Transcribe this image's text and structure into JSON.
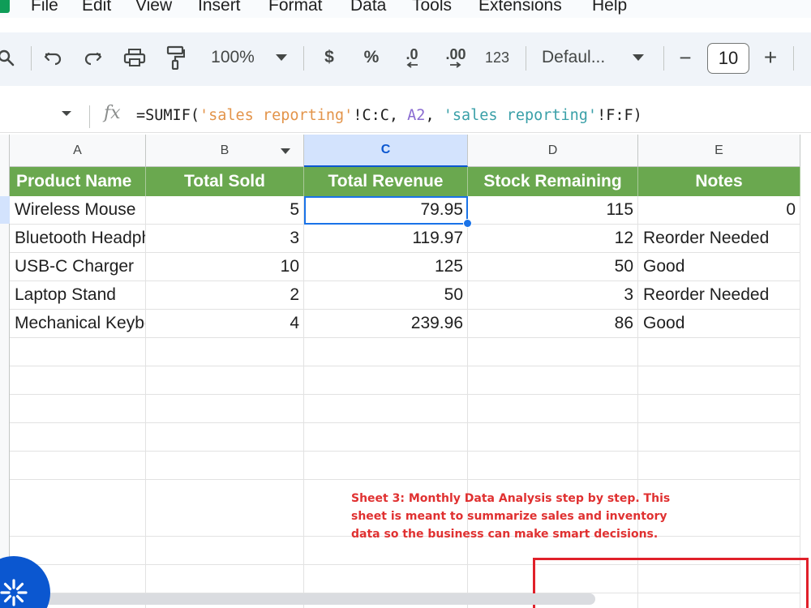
{
  "menu": [
    "File",
    "Edit",
    "View",
    "Insert",
    "Format",
    "Data",
    "Tools",
    "Extensions",
    "Help"
  ],
  "toolbar": {
    "zoom": "100%",
    "currency": "$",
    "percent": "%",
    "decrease_decimal": ".0",
    "increase_decimal": ".00",
    "number_format": "123",
    "font": "Defaul...",
    "decrease_size": "−",
    "font_size": "10",
    "increase_size": "+"
  },
  "formula_bar": {
    "fx": "fx",
    "formula_parts": [
      "=SUMIF(",
      "'sales reporting'",
      "!C:C, ",
      "A2",
      ", ",
      "'sales reporting'",
      "!F:F)"
    ]
  },
  "columns": [
    "A",
    "B",
    "C",
    "D",
    "E"
  ],
  "table": {
    "headers": [
      "Product Name",
      "Total Sold",
      "Total Revenue",
      "Stock Remaining",
      "Notes"
    ],
    "rows": [
      [
        "Wireless Mouse",
        "5",
        "79.95",
        "115",
        "0"
      ],
      [
        "Bluetooth Headphones",
        "3",
        "119.97",
        "12",
        "Reorder Needed"
      ],
      [
        "USB-C Charger",
        "10",
        "125",
        "50",
        "Good"
      ],
      [
        "Laptop Stand",
        "2",
        "50",
        "3",
        "Reorder Needed"
      ],
      [
        "Mechanical Keyboard",
        "4",
        "239.96",
        "86",
        "Good"
      ]
    ]
  },
  "note": "Sheet 3: Monthly Data Analysis step by step. This sheet is meant to summarize sales and inventory data so the business can make smart decisions.",
  "colors": {
    "header_green": "#6aa84f",
    "selection_blue": "#1a73e8",
    "note_red": "#e03131",
    "toolbar_bg": "#f0f4f9"
  }
}
